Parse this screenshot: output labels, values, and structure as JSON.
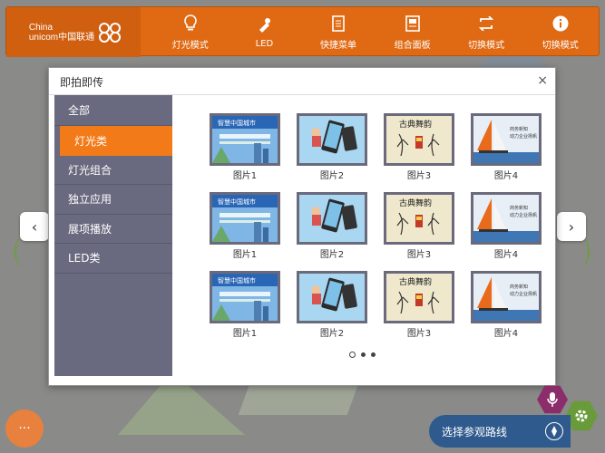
{
  "brand": {
    "logo_line1": "China",
    "logo_line2": "unicom中国联通"
  },
  "nav": [
    {
      "label": "灯光模式",
      "icon": "lightbulb-icon"
    },
    {
      "label": "LED",
      "icon": "flashlight-icon"
    },
    {
      "label": "快捷菜单",
      "icon": "document-icon"
    },
    {
      "label": "组合面板",
      "icon": "panel-icon"
    },
    {
      "label": "切换模式",
      "icon": "switch-icon"
    },
    {
      "label": "切换模式",
      "icon": "info-icon"
    }
  ],
  "modal": {
    "title": "即拍即传",
    "close": "×",
    "categories": [
      "全部",
      "灯光类",
      "灯光组合",
      "独立应用",
      "展项播放",
      "LED类"
    ],
    "active_category": 1,
    "images": [
      {
        "label": "图片1",
        "type": "city-poster"
      },
      {
        "label": "图片2",
        "type": "phone-ad"
      },
      {
        "label": "图片3",
        "type": "ink-drawing"
      },
      {
        "label": "图片4",
        "type": "sailboat"
      },
      {
        "label": "图片1",
        "type": "city-poster"
      },
      {
        "label": "图片2",
        "type": "phone-ad"
      },
      {
        "label": "图片3",
        "type": "ink-drawing"
      },
      {
        "label": "图片4",
        "type": "sailboat"
      },
      {
        "label": "图片1",
        "type": "city-poster"
      },
      {
        "label": "图片2",
        "type": "phone-ad"
      },
      {
        "label": "图片3",
        "type": "ink-drawing"
      },
      {
        "label": "图片4",
        "type": "sailboat"
      }
    ],
    "pagination": {
      "pages": 3,
      "current": 1
    }
  },
  "left_arrow": "‹",
  "right_arrow": "›",
  "more_button": "···",
  "route_bar": {
    "label": "选择参观路线"
  },
  "colors": {
    "accent": "#e06a14",
    "sidebar": "#69697f",
    "active": "#f37a18",
    "route": "#2f5a8d"
  }
}
